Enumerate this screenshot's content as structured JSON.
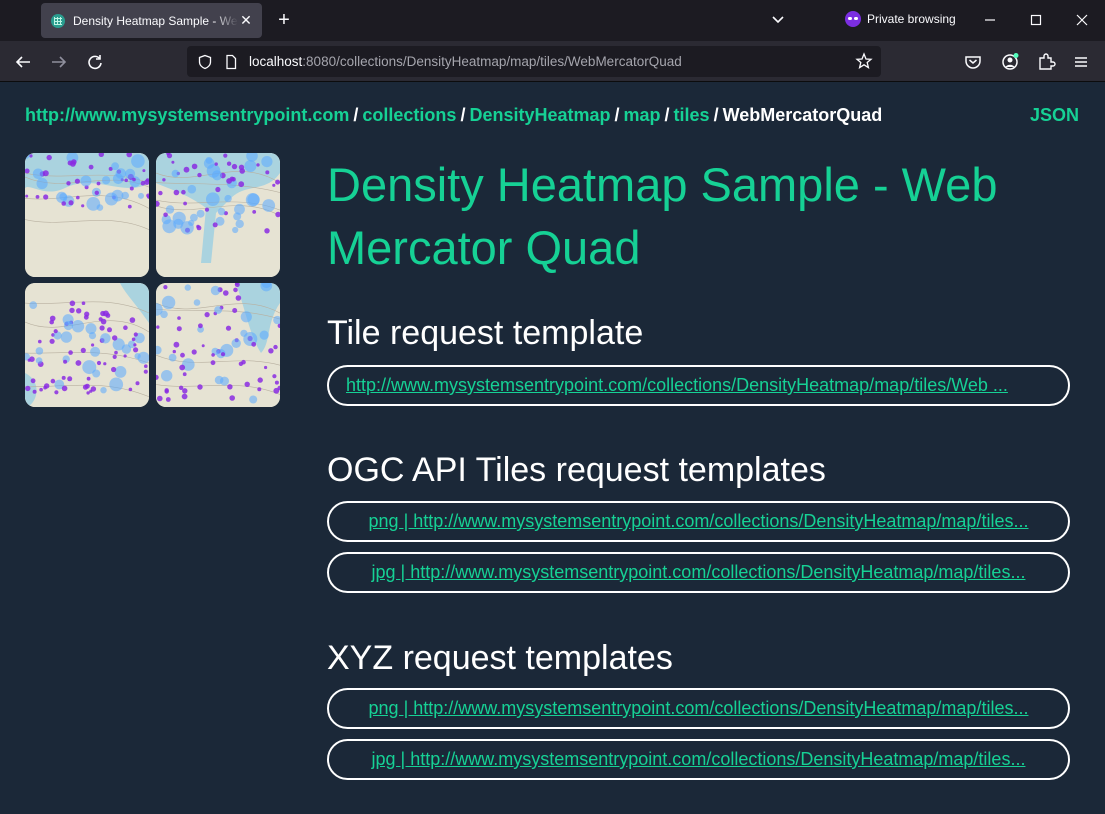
{
  "browser": {
    "tab_title": "Density Heatmap Sample - Web Mercator Quad",
    "tab_close": "✕",
    "new_tab": "+",
    "private_label": "Private browsing",
    "url_host": "localhost",
    "url_rest": ":8080/collections/DensityHeatmap/map/tiles/WebMercatorQuad"
  },
  "breadcrumb": {
    "items": [
      "http://www.mysystemsentrypoint.com",
      "collections",
      "DensityHeatmap",
      "map",
      "tiles"
    ],
    "current": "WebMercatorQuad",
    "separator": "/"
  },
  "json_link": "JSON",
  "title": "Density Heatmap Sample - Web Mercator Quad",
  "sections": {
    "tile_request": {
      "heading": "Tile request template",
      "url": "http://www.mysystemsentrypoint.com/collections/DensityHeatmap/map/tiles/Web ..."
    },
    "ogc": {
      "heading": "OGC API Tiles request templates",
      "png": "png | http://www.mysystemsentrypoint.com/collections/DensityHeatmap/map/tiles...",
      "jpg": "jpg | http://www.mysystemsentrypoint.com/collections/DensityHeatmap/map/tiles..."
    },
    "xyz": {
      "heading": "XYZ request templates",
      "png": "png | http://www.mysystemsentrypoint.com/collections/DensityHeatmap/map/tiles...",
      "jpg": "jpg | http://www.mysystemsentrypoint.com/collections/DensityHeatmap/map/tiles..."
    }
  },
  "colors": {
    "accent": "#16d195",
    "background": "#1b2838",
    "heat_low": "#8a2be2",
    "heat_high": "#5aa9ff",
    "map_land": "#e6e3d3",
    "map_water": "#aad3df"
  }
}
